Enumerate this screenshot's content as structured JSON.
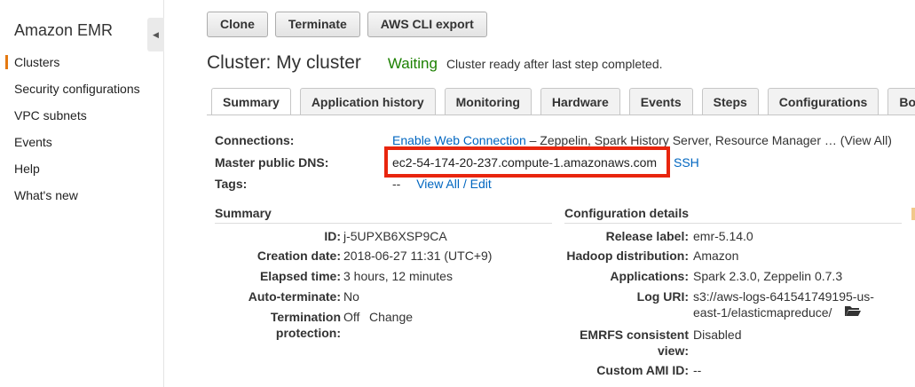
{
  "sidebar": {
    "brand": "Amazon EMR",
    "items": [
      {
        "label": "Clusters"
      },
      {
        "label": "Security configurations"
      },
      {
        "label": "VPC subnets"
      },
      {
        "label": "Events"
      },
      {
        "label": "Help"
      },
      {
        "label": "What's new"
      }
    ]
  },
  "toolbar": {
    "clone_label": "Clone",
    "terminate_label": "Terminate",
    "cli_export_label": "AWS CLI export"
  },
  "header": {
    "title": "Cluster: My cluster",
    "status": "Waiting",
    "status_message": "Cluster ready after last step completed."
  },
  "tabs": [
    {
      "label": "Summary"
    },
    {
      "label": "Application history"
    },
    {
      "label": "Monitoring"
    },
    {
      "label": "Hardware"
    },
    {
      "label": "Events"
    },
    {
      "label": "Steps"
    },
    {
      "label": "Configurations"
    },
    {
      "label": "Bootstr"
    }
  ],
  "connections": {
    "label": "Connections:",
    "link": "Enable Web Connection",
    "rest": " – Zeppelin, Spark History Server, Resource Manager … ",
    "view_all": "(View All)"
  },
  "master_dns": {
    "label": "Master public DNS:",
    "value": "ec2-54-174-20-237.compute-1.amazonaws.com",
    "ssh": "SSH"
  },
  "tags": {
    "label": "Tags:",
    "value": "--",
    "link": "View All / Edit"
  },
  "summary": {
    "heading": "Summary",
    "id_label": "ID:",
    "id_value": "j-5UPXB6XSP9CA",
    "creation_label": "Creation date:",
    "creation_value": "2018-06-27 11:31 (UTC+9)",
    "elapsed_label": "Elapsed time:",
    "elapsed_value": "3 hours, 12 minutes",
    "auto_label": "Auto-terminate:",
    "auto_value": "No",
    "term_label_1": "Termination",
    "term_label_2": "protection:",
    "term_value": "Off",
    "term_link": "Change"
  },
  "config": {
    "heading": "Configuration details",
    "release_label": "Release label:",
    "release_value": "emr-5.14.0",
    "hadoop_label": "Hadoop distribution:",
    "hadoop_value": "Amazon",
    "apps_label": "Applications:",
    "apps_value": "Spark 2.3.0, Zeppelin 0.7.3",
    "log_label": "Log URI:",
    "log_value_1": "s3://aws-logs-641541749195-us-",
    "log_value_2": "east-1/elasticmapreduce/",
    "emrfs_label_1": "EMRFS consistent",
    "emrfs_label_2": "view:",
    "emrfs_value": "Disabled",
    "ami_label": "Custom AMI ID:",
    "ami_value": "--"
  },
  "colors": {
    "status_green": "#1d8102",
    "link_blue": "#0066c0",
    "highlight_red": "#e8250e",
    "active_orange": "#e47911"
  }
}
